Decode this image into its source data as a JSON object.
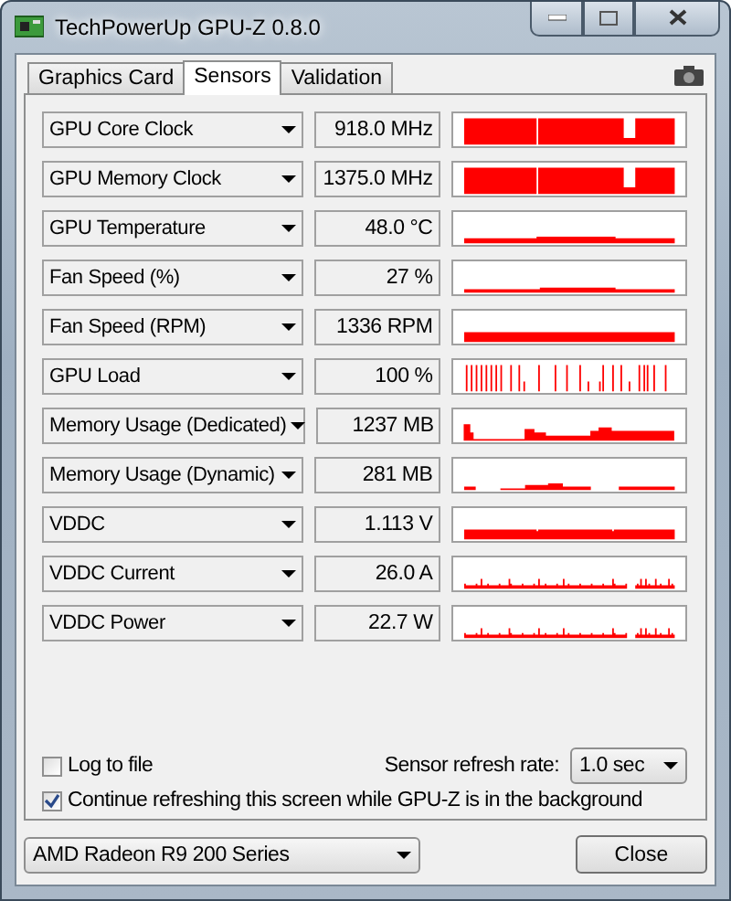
{
  "window": {
    "title": "TechPowerUp GPU-Z 0.8.0"
  },
  "tabs": [
    {
      "label": "Graphics Card",
      "selected": false
    },
    {
      "label": "Sensors",
      "selected": true
    },
    {
      "label": "Validation",
      "selected": false
    }
  ],
  "sensors": [
    {
      "name": "GPU Core Clock",
      "reading": "918.0 MHz"
    },
    {
      "name": "GPU Memory Clock",
      "reading": "1375.0 MHz"
    },
    {
      "name": "GPU Temperature",
      "reading": "48.0 °C"
    },
    {
      "name": "Fan Speed (%)",
      "reading": "27 %"
    },
    {
      "name": "Fan Speed (RPM)",
      "reading": "1336 RPM"
    },
    {
      "name": "GPU Load",
      "reading": "100 %"
    },
    {
      "name": "Memory Usage (Dedicated)",
      "reading": "1237 MB"
    },
    {
      "name": "Memory Usage (Dynamic)",
      "reading": "281 MB"
    },
    {
      "name": "VDDC",
      "reading": "1.113 V"
    },
    {
      "name": "VDDC Current",
      "reading": "26.0 A"
    },
    {
      "name": "VDDC Power",
      "reading": "22.7 W"
    }
  ],
  "log_to_file": {
    "label": "Log to file",
    "checked": false
  },
  "refresh_rate": {
    "label": "Sensor refresh rate:",
    "value": "1.0 sec"
  },
  "continue_refreshing": {
    "label": "Continue refreshing this screen while GPU-Z is in the background",
    "checked": true
  },
  "card_select": {
    "value": "AMD Radeon R9 200 Series"
  },
  "close_button": "Close"
}
